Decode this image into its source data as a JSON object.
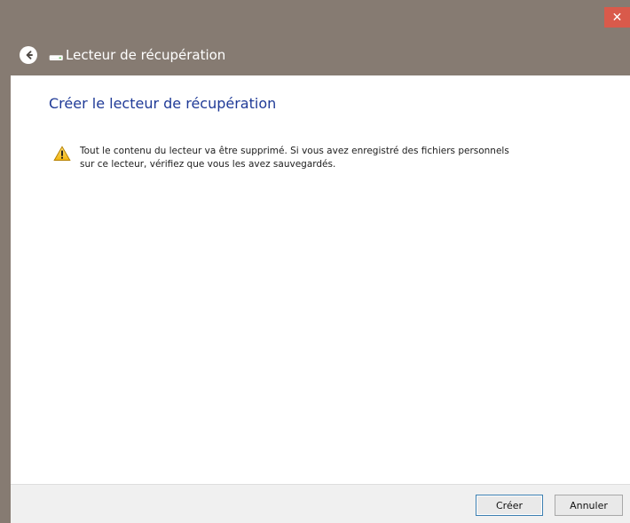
{
  "window": {
    "title": "Lecteur de récupération",
    "controls": {
      "close_glyph": "✕"
    }
  },
  "content": {
    "heading": "Créer le lecteur de récupération",
    "warning": {
      "line1": "Tout le contenu du lecteur va être supprimé. Si vous avez enregistré des fichiers personnels",
      "line2": "sur ce lecteur, vérifiez que vous les avez sauvegardés."
    }
  },
  "buttons": {
    "create_label": "Créer",
    "cancel_label": "Annuler"
  },
  "icons": {
    "back": "back-arrow-icon",
    "drive": "drive-icon",
    "warning": "warning-icon",
    "close": "close-icon"
  },
  "colors": {
    "chrome": "#867b72",
    "accent_heading": "#1f3a97",
    "close_button": "#d95a4b",
    "footer_bg": "#f0f0f0"
  }
}
